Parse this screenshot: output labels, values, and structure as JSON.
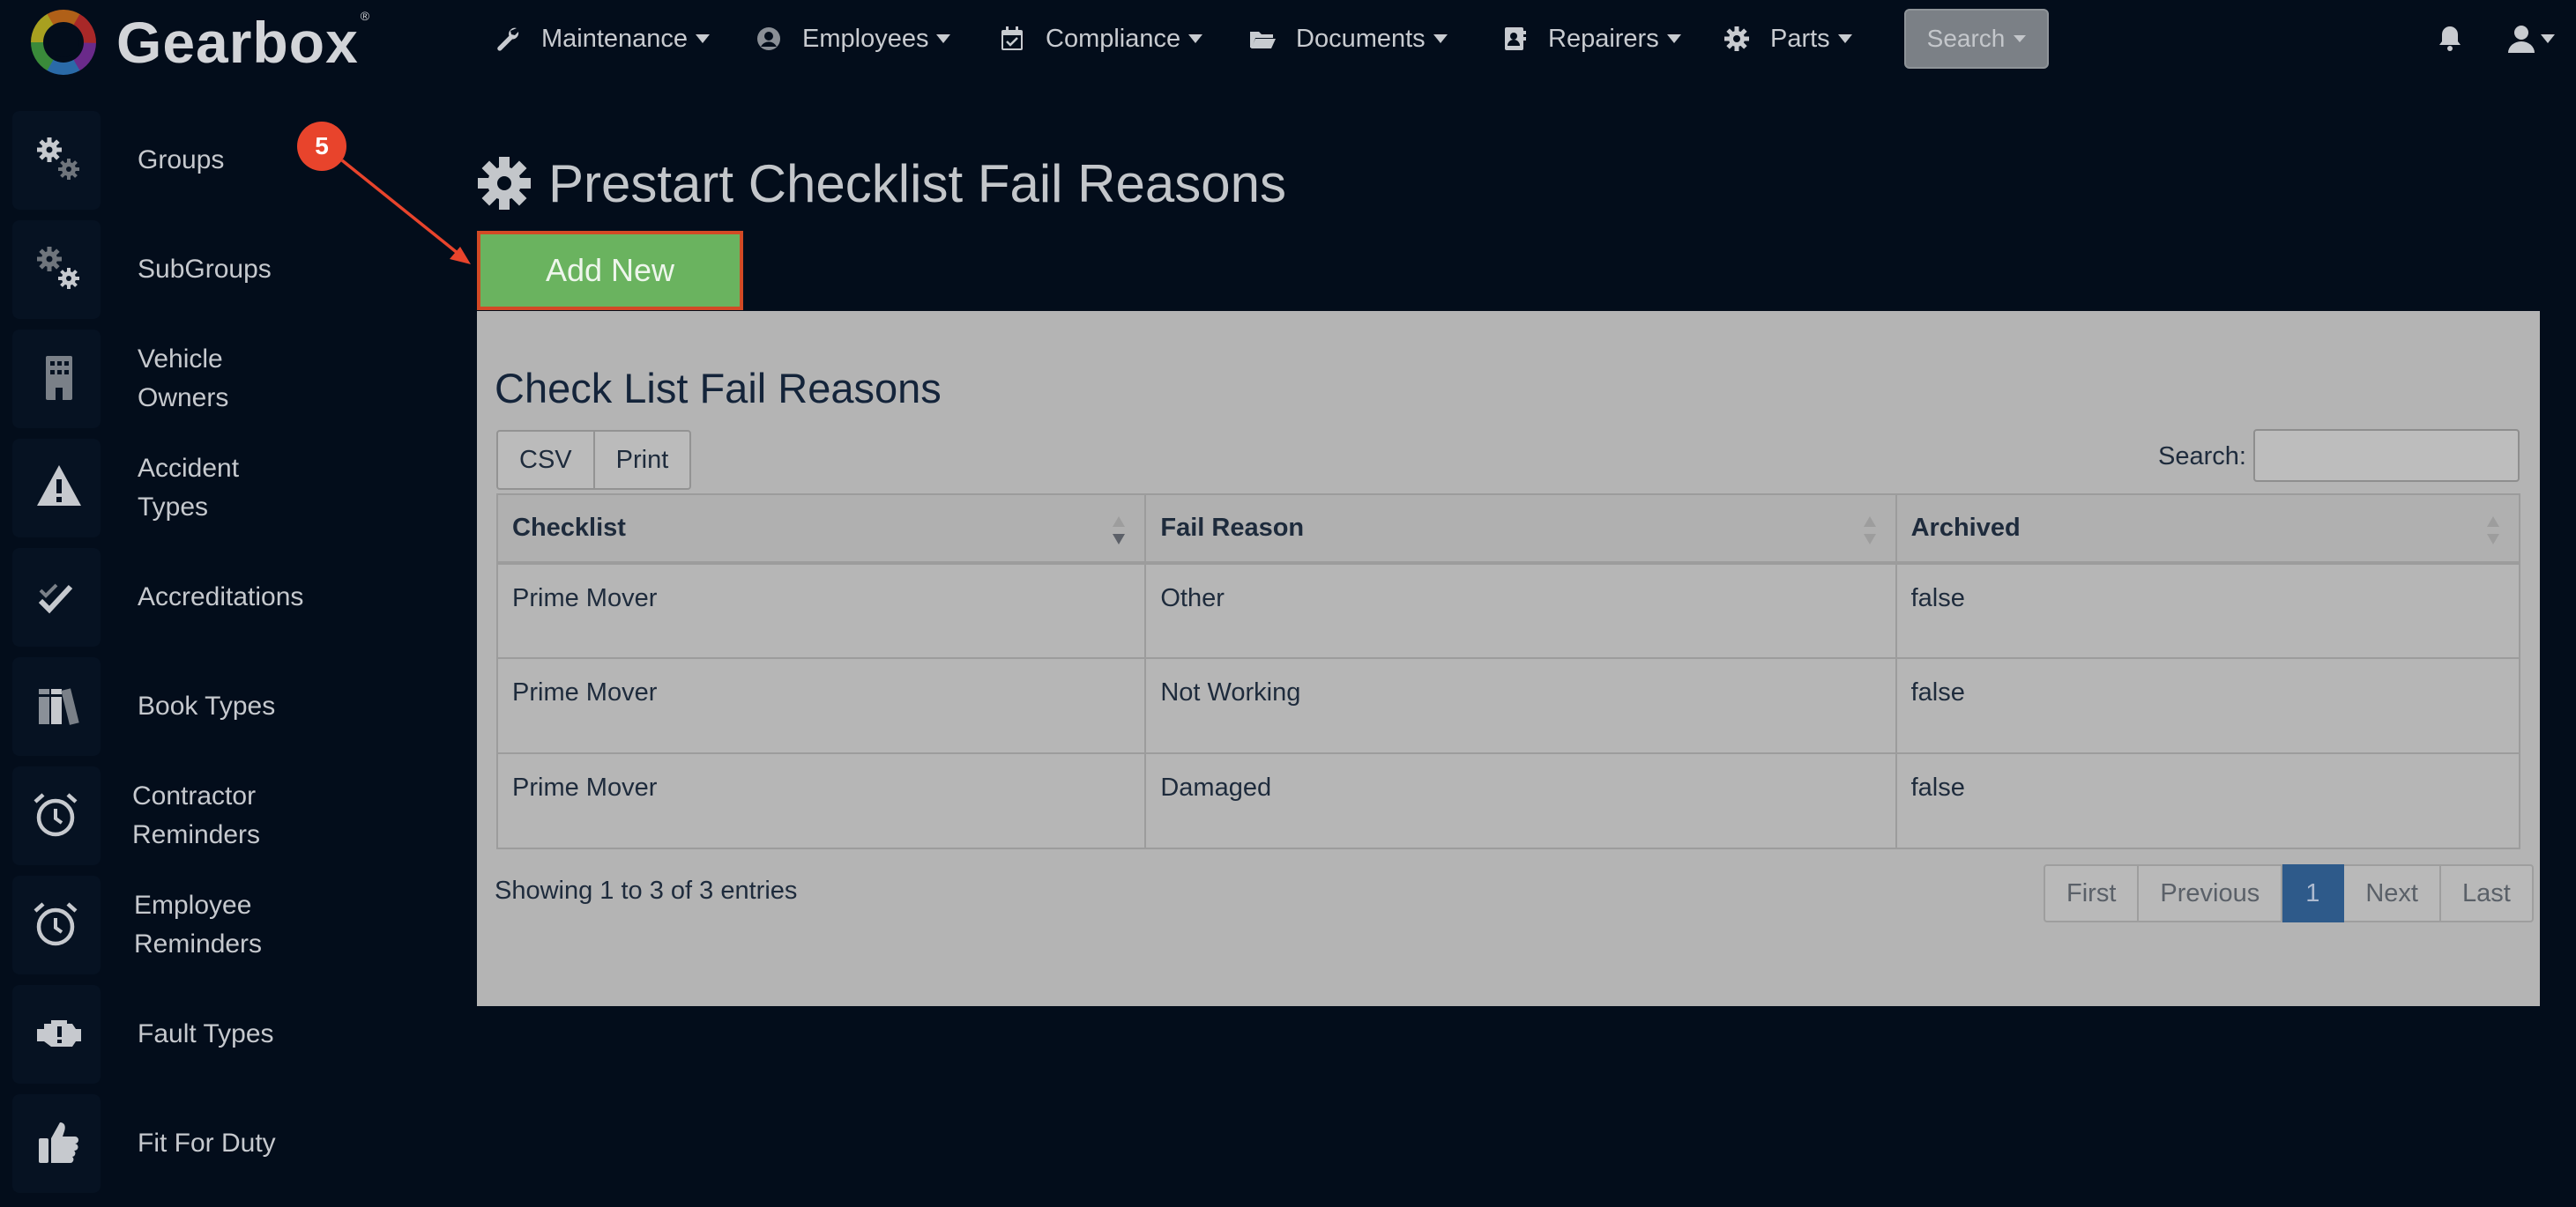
{
  "brand": {
    "name": "Gearbox",
    "registered": "®"
  },
  "nav": {
    "items": [
      {
        "label": "Maintenance",
        "icon": "wrench-icon"
      },
      {
        "label": "Employees",
        "icon": "user-circle-icon"
      },
      {
        "label": "Compliance",
        "icon": "calendar-check-icon"
      },
      {
        "label": "Documents",
        "icon": "folder-open-icon"
      },
      {
        "label": "Repairers",
        "icon": "address-book-icon"
      },
      {
        "label": "Parts",
        "icon": "gear-icon"
      }
    ],
    "search_label": "Search"
  },
  "sidebar": {
    "items": [
      {
        "label": "Groups",
        "icon": "gears-icon"
      },
      {
        "label": "SubGroups",
        "icon": "gears-icon"
      },
      {
        "label": "Vehicle Owners",
        "icon": "building-icon"
      },
      {
        "label": "Accident Types",
        "icon": "warning-icon"
      },
      {
        "label": "Accreditations",
        "icon": "check-icon"
      },
      {
        "label": "Book Types",
        "icon": "books-icon"
      },
      {
        "label": "Contractor Reminders",
        "icon": "alarm-clock-icon"
      },
      {
        "label": "Employee Reminders",
        "icon": "alarm-clock-icon"
      },
      {
        "label": "Fault Types",
        "icon": "engine-warning-icon"
      },
      {
        "label": "Fit For Duty",
        "icon": "thumbs-up-icon"
      }
    ]
  },
  "main": {
    "page_title": "Prestart Checklist Fail Reasons",
    "add_new_label": "Add New",
    "panel_title": "Check List Fail Reasons",
    "export_buttons": {
      "csv": "CSV",
      "print": "Print"
    },
    "search_label": "Search:",
    "table": {
      "columns": [
        "Checklist",
        "Fail Reason",
        "Archived"
      ],
      "rows": [
        [
          "Prime Mover",
          "Other",
          "false"
        ],
        [
          "Prime Mover",
          "Not Working",
          "false"
        ],
        [
          "Prime Mover",
          "Damaged",
          "false"
        ]
      ]
    },
    "info": "Showing 1 to 3 of 3 entries",
    "pagination": {
      "first": "First",
      "previous": "Previous",
      "current": "1",
      "next": "Next",
      "last": "Last"
    }
  },
  "annotation": {
    "step": "5",
    "color": "#e8442c"
  },
  "colors": {
    "background": "#030d1b",
    "add_new": "#6ab35f",
    "highlight": "#d24a25",
    "current_page": "#2e5a8a"
  }
}
